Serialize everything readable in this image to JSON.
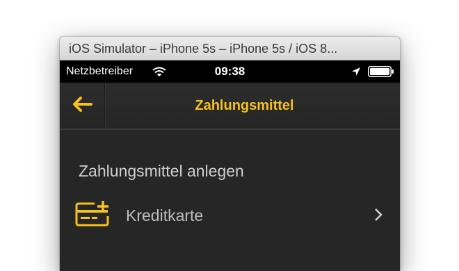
{
  "window": {
    "title": "iOS Simulator – iPhone 5s – iPhone 5s / iOS 8..."
  },
  "status_bar": {
    "carrier": "Netzbetreiber",
    "time": "09:38"
  },
  "nav_bar": {
    "title": "Zahlungsmittel"
  },
  "content": {
    "section_title": "Zahlungsmittel anlegen",
    "rows": [
      {
        "label": "Kreditkarte",
        "icon": "credit-card-add-icon"
      }
    ]
  },
  "colors": {
    "accent": "#f5c21a",
    "background": "#262626",
    "text_muted": "#bdbdbd"
  }
}
